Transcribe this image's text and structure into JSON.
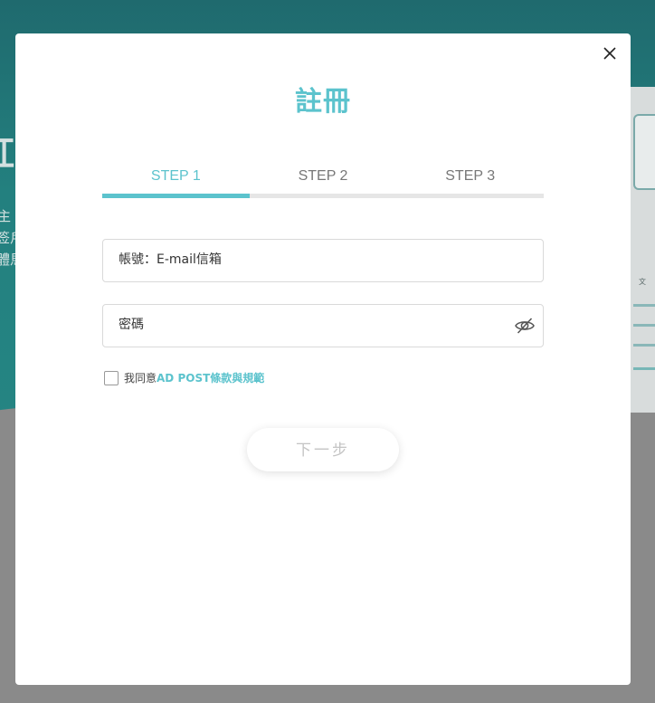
{
  "modal": {
    "title": "註冊",
    "close_icon": "close-icon"
  },
  "steps": [
    {
      "label": "STEP 1",
      "active": true
    },
    {
      "label": "STEP 2",
      "active": false
    },
    {
      "label": "STEP 3",
      "active": false
    }
  ],
  "form": {
    "account": {
      "value": "",
      "placeholder": "帳號：E-mail信箱"
    },
    "password": {
      "value": "",
      "placeholder": "密碼",
      "toggle_icon": "eye-slash-icon"
    },
    "agree": {
      "checked": false,
      "text": "我同意",
      "link_text": "AD POST條款與規範"
    },
    "next_label": "下一步"
  },
  "background": {
    "left_fragments": [
      "紅",
      "主",
      "签戶",
      "體馬"
    ],
    "right_fragment": "文"
  },
  "colors": {
    "accent": "#5cc3cd",
    "backdrop": "#8a8a8a",
    "band": "#23807f",
    "disabled_text": "#c4c4c4"
  }
}
